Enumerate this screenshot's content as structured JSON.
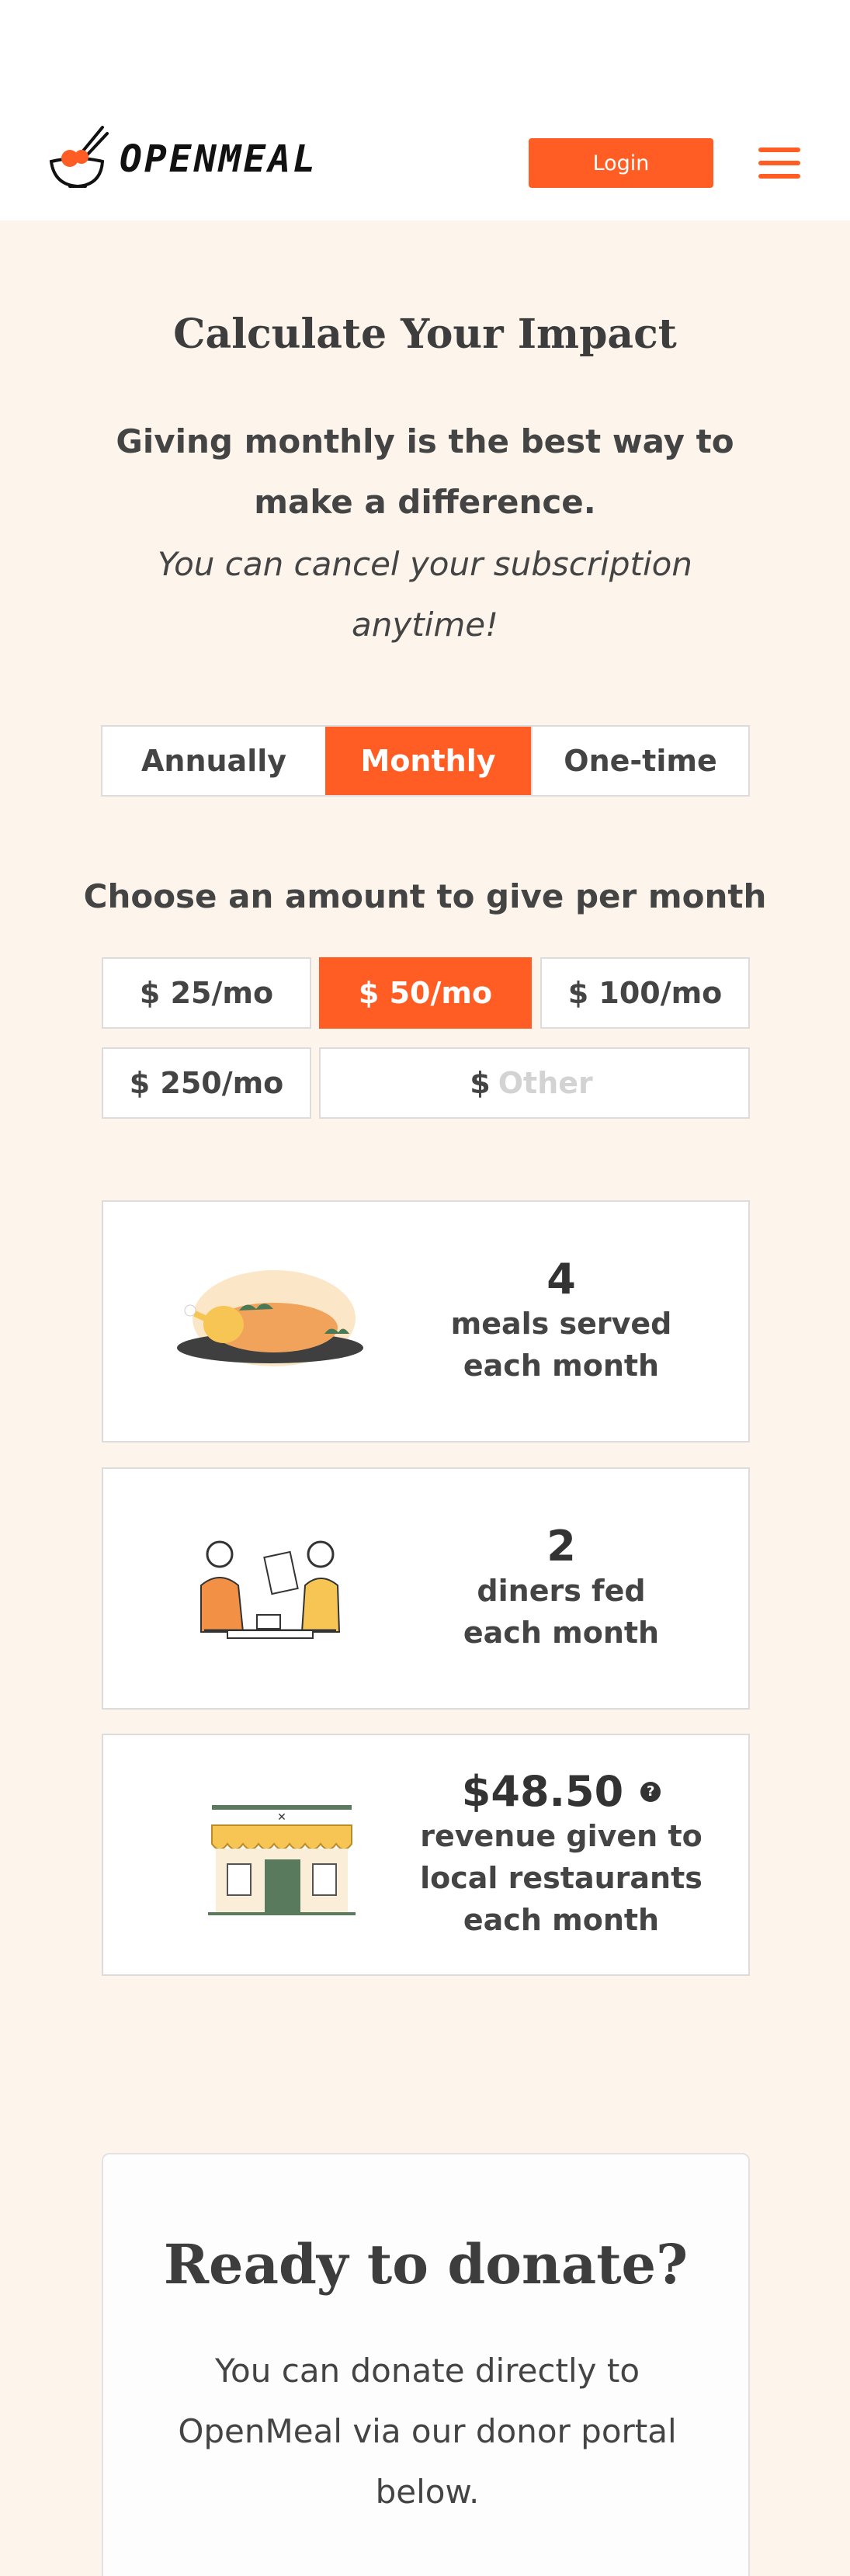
{
  "brand": {
    "name": "OPENMEAL",
    "accent_color": "#ff5d24",
    "background_color": "#fdf5ec"
  },
  "header": {
    "login_label": "Login",
    "menu_icon": "hamburger-icon"
  },
  "calculator": {
    "heading": "Calculate Your Impact",
    "intro_bold": "Giving monthly is the best way to make a difference.",
    "intro_italic": "You can cancel your subscription anytime!",
    "frequency_tabs": [
      {
        "label": "Annually",
        "active": false
      },
      {
        "label": "Monthly",
        "active": true
      },
      {
        "label": "One-time",
        "active": false
      }
    ],
    "choose_label": "Choose an amount to give per month",
    "amounts": [
      {
        "label": "$ 25/mo",
        "active": false
      },
      {
        "label": "$ 50/mo",
        "active": true
      },
      {
        "label": "$ 100/mo",
        "active": false
      },
      {
        "label": "$ 250/mo",
        "active": false
      }
    ],
    "other": {
      "currency": "$",
      "placeholder": "Other"
    }
  },
  "impact": [
    {
      "value": "4",
      "label_line1": "meals served",
      "label_line2": "each month",
      "icon": "roast-chicken-illustration"
    },
    {
      "value": "2",
      "label_line1": "diners fed",
      "label_line2": "each month",
      "icon": "diners-illustration"
    },
    {
      "value": "$48.50",
      "label_line1": "revenue given to",
      "label_line2": "local restaurants",
      "label_line3": "each month",
      "icon": "storefront-illustration",
      "help_icon": "?"
    }
  ],
  "donate": {
    "title": "Ready to donate?",
    "text": "You can donate directly to OpenMeal via our donor portal below."
  }
}
